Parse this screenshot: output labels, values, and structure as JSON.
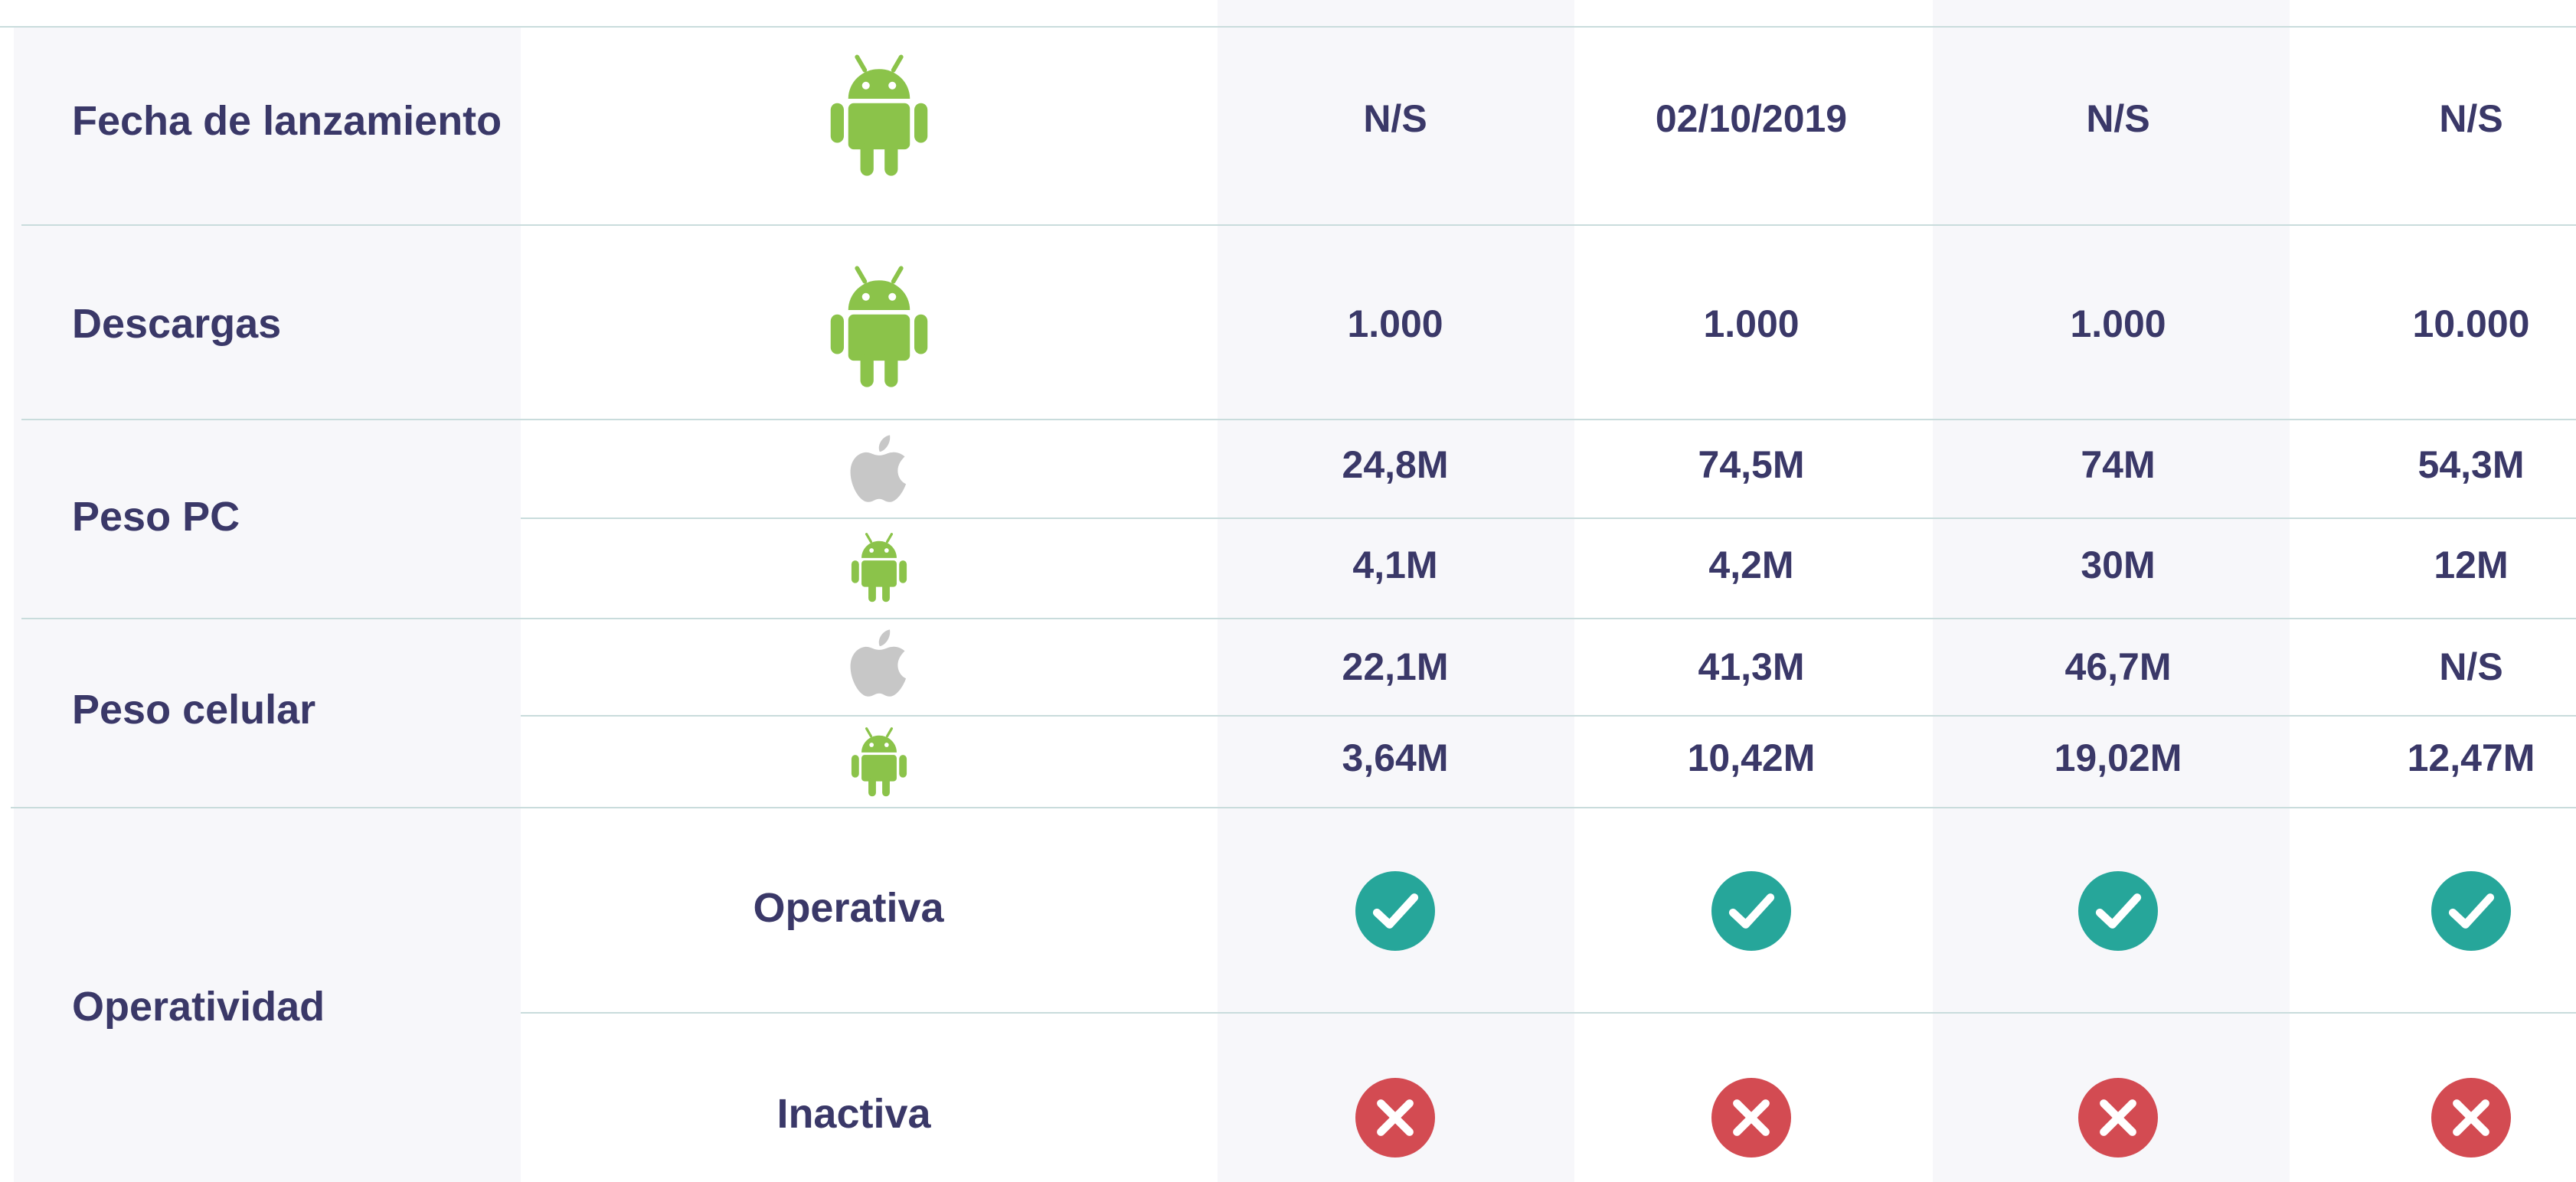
{
  "colors": {
    "android": "#8bc34a",
    "apple": "#c7c7c7",
    "check": "#26a69a",
    "cross": "#d34b52",
    "text": "#3a3868"
  },
  "rows": {
    "fecha": {
      "label": "Fecha de lanzamiento",
      "platform_icon": "android-icon",
      "values": [
        "N/S",
        "02/10/2019",
        "N/S",
        "N/S"
      ]
    },
    "descargas": {
      "label": "Descargas",
      "platform_icon": "android-icon",
      "values": [
        "1.000",
        "1.000",
        "1.000",
        "10.000"
      ]
    },
    "peso_pc": {
      "label": "Peso PC",
      "apple_values": [
        "24,8M",
        "74,5M",
        "74M",
        "54,3M"
      ],
      "android_values": [
        "4,1M",
        "4,2M",
        "30M",
        "12M"
      ]
    },
    "peso_celular": {
      "label": "Peso celular",
      "apple_values": [
        "22,1M",
        "41,3M",
        "46,7M",
        "N/S"
      ],
      "android_values": [
        "3,64M",
        "10,42M",
        "19,02M",
        "12,47M"
      ]
    },
    "operatividad": {
      "label": "Operatividad",
      "operativa_label": "Operativa",
      "inactiva_label": "Inactiva",
      "operativa_icons": [
        "check-circle-icon",
        "check-circle-icon",
        "check-circle-icon",
        "check-circle-icon"
      ],
      "inactiva_icons": [
        "cross-circle-icon",
        "cross-circle-icon",
        "cross-circle-icon",
        "cross-circle-icon"
      ]
    }
  }
}
